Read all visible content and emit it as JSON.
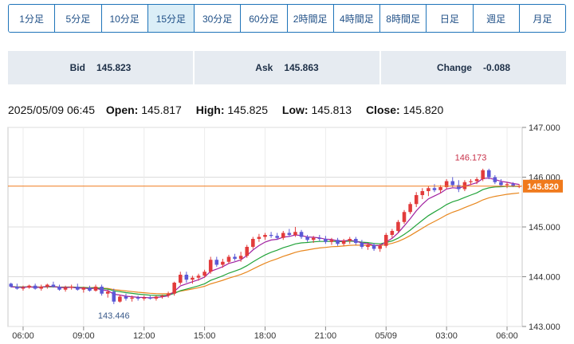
{
  "timeframes": [
    {
      "label": "1分足",
      "active": false
    },
    {
      "label": "5分足",
      "active": false
    },
    {
      "label": "10分足",
      "active": false
    },
    {
      "label": "15分足",
      "active": true
    },
    {
      "label": "30分足",
      "active": false
    },
    {
      "label": "60分足",
      "active": false
    },
    {
      "label": "2時間足",
      "active": false
    },
    {
      "label": "4時間足",
      "active": false
    },
    {
      "label": "8時間足",
      "active": false
    },
    {
      "label": "日足",
      "active": false
    },
    {
      "label": "週足",
      "active": false
    },
    {
      "label": "月足",
      "active": false
    }
  ],
  "quotes": {
    "bid_label": "Bid",
    "bid_value": "145.823",
    "ask_label": "Ask",
    "ask_value": "145.863",
    "change_label": "Change",
    "change_value": "-0.088"
  },
  "ohlc": {
    "datetime": "2025/05/09 06:45",
    "open_label": "Open:",
    "open": "145.817",
    "high_label": "High:",
    "high": "145.825",
    "low_label": "Low:",
    "low": "145.813",
    "close_label": "Close:",
    "close": "145.820"
  },
  "chart_data": {
    "type": "candlestick",
    "y_ticks": [
      "147.000",
      "146.000",
      "145.000",
      "144.000",
      "143.000"
    ],
    "ylim": [
      143.0,
      147.0
    ],
    "x_ticks": [
      {
        "label": "06:00",
        "i": 2
      },
      {
        "label": "09:00",
        "i": 12
      },
      {
        "label": "12:00",
        "i": 22
      },
      {
        "label": "15:00",
        "i": 32
      },
      {
        "label": "18:00",
        "i": 42
      },
      {
        "label": "21:00",
        "i": 52
      },
      {
        "label": "05/09",
        "i": 62
      },
      {
        "label": "03:00",
        "i": 72
      },
      {
        "label": "06:00",
        "i": 82
      }
    ],
    "n_slots": 85,
    "current_price": "145.820",
    "current_value": 145.82,
    "annotations": [
      {
        "label": "146.173",
        "i": 76,
        "value": 146.173,
        "pos": "above"
      },
      {
        "label": "143.446",
        "i": 17,
        "value": 143.446,
        "pos": "below"
      }
    ],
    "candles": [
      [
        143.86,
        143.88,
        143.78,
        143.8
      ],
      [
        143.8,
        143.86,
        143.74,
        143.76
      ],
      [
        143.76,
        143.82,
        143.72,
        143.78
      ],
      [
        143.78,
        143.84,
        143.76,
        143.82
      ],
      [
        143.82,
        143.86,
        143.74,
        143.76
      ],
      [
        143.76,
        143.84,
        143.72,
        143.8
      ],
      [
        143.8,
        143.86,
        143.76,
        143.84
      ],
      [
        143.84,
        143.9,
        143.78,
        143.8
      ],
      [
        143.8,
        143.84,
        143.72,
        143.74
      ],
      [
        143.74,
        143.82,
        143.7,
        143.78
      ],
      [
        143.78,
        143.84,
        143.74,
        143.8
      ],
      [
        143.8,
        143.86,
        143.72,
        143.74
      ],
      [
        143.74,
        143.8,
        143.68,
        143.78
      ],
      [
        143.78,
        143.82,
        143.7,
        143.72
      ],
      [
        143.72,
        143.84,
        143.7,
        143.8
      ],
      [
        143.8,
        143.84,
        143.62,
        143.66
      ],
      [
        143.66,
        143.74,
        143.58,
        143.7
      ],
      [
        143.7,
        143.76,
        143.45,
        143.5
      ],
      [
        143.5,
        143.64,
        143.48,
        143.6
      ],
      [
        143.6,
        143.66,
        143.52,
        143.56
      ],
      [
        143.56,
        143.62,
        143.5,
        143.58
      ],
      [
        143.58,
        143.62,
        143.52,
        143.56
      ],
      [
        143.56,
        143.62,
        143.52,
        143.58
      ],
      [
        143.58,
        143.62,
        143.54,
        143.56
      ],
      [
        143.56,
        143.62,
        143.52,
        143.6
      ],
      [
        143.6,
        143.64,
        143.56,
        143.62
      ],
      [
        143.62,
        143.7,
        143.58,
        143.66
      ],
      [
        143.66,
        143.9,
        143.62,
        143.88
      ],
      [
        143.88,
        144.1,
        143.84,
        144.04
      ],
      [
        144.04,
        144.1,
        143.88,
        143.94
      ],
      [
        143.94,
        144.02,
        143.86,
        143.98
      ],
      [
        143.98,
        144.06,
        143.92,
        144.02
      ],
      [
        144.02,
        144.14,
        143.98,
        144.1
      ],
      [
        144.1,
        144.4,
        144.06,
        144.34
      ],
      [
        144.34,
        144.4,
        144.2,
        144.24
      ],
      [
        144.24,
        144.36,
        144.18,
        144.3
      ],
      [
        144.3,
        144.44,
        144.26,
        144.4
      ],
      [
        144.4,
        144.46,
        144.32,
        144.36
      ],
      [
        144.36,
        144.5,
        144.3,
        144.42
      ],
      [
        144.42,
        144.64,
        144.38,
        144.6
      ],
      [
        144.6,
        144.8,
        144.56,
        144.76
      ],
      [
        144.76,
        144.86,
        144.7,
        144.8
      ],
      [
        144.8,
        144.88,
        144.74,
        144.84
      ],
      [
        144.84,
        144.9,
        144.78,
        144.82
      ],
      [
        144.82,
        144.88,
        144.74,
        144.78
      ],
      [
        144.78,
        144.92,
        144.74,
        144.88
      ],
      [
        144.88,
        144.96,
        144.8,
        144.84
      ],
      [
        144.84,
        145.0,
        144.8,
        144.9
      ],
      [
        144.9,
        144.94,
        144.76,
        144.8
      ],
      [
        144.8,
        144.84,
        144.7,
        144.74
      ],
      [
        144.74,
        144.82,
        144.68,
        144.78
      ],
      [
        144.78,
        144.84,
        144.72,
        144.76
      ],
      [
        144.76,
        144.82,
        144.66,
        144.7
      ],
      [
        144.7,
        144.78,
        144.64,
        144.74
      ],
      [
        144.74,
        144.78,
        144.62,
        144.66
      ],
      [
        144.66,
        144.76,
        144.62,
        144.72
      ],
      [
        144.72,
        144.8,
        144.66,
        144.76
      ],
      [
        144.76,
        144.8,
        144.64,
        144.68
      ],
      [
        144.68,
        144.74,
        144.56,
        144.6
      ],
      [
        144.6,
        144.68,
        144.54,
        144.64
      ],
      [
        144.64,
        144.68,
        144.52,
        144.56
      ],
      [
        144.56,
        144.66,
        144.5,
        144.62
      ],
      [
        144.62,
        144.88,
        144.58,
        144.84
      ],
      [
        144.84,
        144.96,
        144.78,
        144.92
      ],
      [
        144.92,
        145.14,
        144.88,
        145.1
      ],
      [
        145.1,
        145.34,
        145.06,
        145.3
      ],
      [
        145.3,
        145.5,
        145.26,
        145.46
      ],
      [
        145.46,
        145.7,
        145.4,
        145.64
      ],
      [
        145.64,
        145.78,
        145.56,
        145.72
      ],
      [
        145.72,
        145.82,
        145.62,
        145.78
      ],
      [
        145.78,
        145.86,
        145.7,
        145.74
      ],
      [
        145.74,
        145.84,
        145.68,
        145.8
      ],
      [
        145.8,
        145.96,
        145.76,
        145.92
      ],
      [
        145.92,
        146.0,
        145.8,
        145.84
      ],
      [
        145.84,
        145.94,
        145.7,
        145.76
      ],
      [
        145.76,
        145.94,
        145.72,
        145.9
      ],
      [
        145.9,
        145.96,
        145.84,
        145.92
      ],
      [
        145.92,
        146.0,
        145.86,
        145.96
      ],
      [
        145.96,
        146.17,
        145.92,
        146.14
      ],
      [
        146.14,
        146.17,
        145.96,
        146.0
      ],
      [
        146.0,
        146.04,
        145.86,
        145.9
      ],
      [
        145.9,
        145.96,
        145.8,
        145.84
      ],
      [
        145.84,
        145.9,
        145.78,
        145.86
      ],
      [
        145.86,
        145.9,
        145.8,
        145.82
      ],
      [
        145.82,
        145.86,
        145.78,
        145.82
      ]
    ],
    "colors": {
      "up": "#e23b3b",
      "down": "#5b59d6",
      "ma_fast": "#a020a0",
      "ma_mid": "#22a33a",
      "ma_slow": "#e8871e",
      "price_tag": "#f07a1c"
    }
  }
}
